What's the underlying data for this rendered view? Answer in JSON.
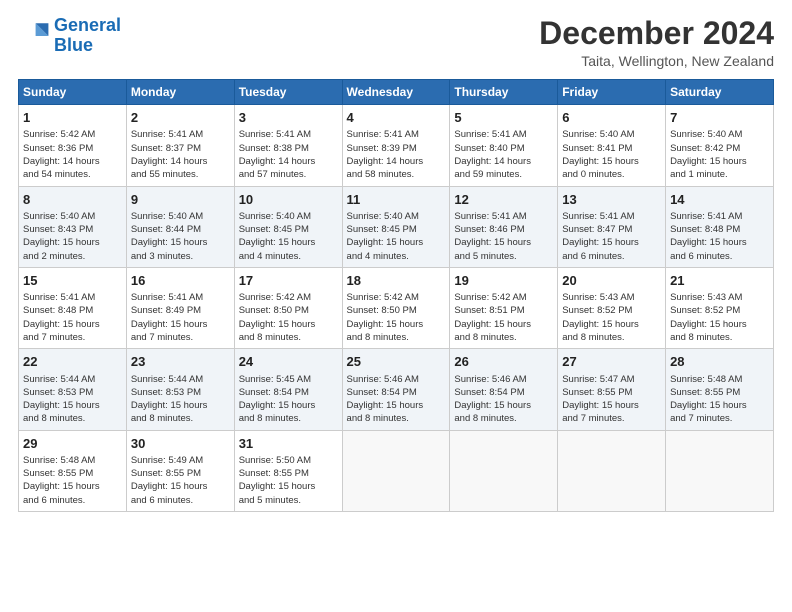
{
  "header": {
    "logo_line1": "General",
    "logo_line2": "Blue",
    "title": "December 2024",
    "subtitle": "Taita, Wellington, New Zealand"
  },
  "days_of_week": [
    "Sunday",
    "Monday",
    "Tuesday",
    "Wednesday",
    "Thursday",
    "Friday",
    "Saturday"
  ],
  "weeks": [
    [
      {
        "day": "1",
        "lines": [
          "Sunrise: 5:42 AM",
          "Sunset: 8:36 PM",
          "Daylight: 14 hours",
          "and 54 minutes."
        ]
      },
      {
        "day": "2",
        "lines": [
          "Sunrise: 5:41 AM",
          "Sunset: 8:37 PM",
          "Daylight: 14 hours",
          "and 55 minutes."
        ]
      },
      {
        "day": "3",
        "lines": [
          "Sunrise: 5:41 AM",
          "Sunset: 8:38 PM",
          "Daylight: 14 hours",
          "and 57 minutes."
        ]
      },
      {
        "day": "4",
        "lines": [
          "Sunrise: 5:41 AM",
          "Sunset: 8:39 PM",
          "Daylight: 14 hours",
          "and 58 minutes."
        ]
      },
      {
        "day": "5",
        "lines": [
          "Sunrise: 5:41 AM",
          "Sunset: 8:40 PM",
          "Daylight: 14 hours",
          "and 59 minutes."
        ]
      },
      {
        "day": "6",
        "lines": [
          "Sunrise: 5:40 AM",
          "Sunset: 8:41 PM",
          "Daylight: 15 hours",
          "and 0 minutes."
        ]
      },
      {
        "day": "7",
        "lines": [
          "Sunrise: 5:40 AM",
          "Sunset: 8:42 PM",
          "Daylight: 15 hours",
          "and 1 minute."
        ]
      }
    ],
    [
      {
        "day": "8",
        "lines": [
          "Sunrise: 5:40 AM",
          "Sunset: 8:43 PM",
          "Daylight: 15 hours",
          "and 2 minutes."
        ]
      },
      {
        "day": "9",
        "lines": [
          "Sunrise: 5:40 AM",
          "Sunset: 8:44 PM",
          "Daylight: 15 hours",
          "and 3 minutes."
        ]
      },
      {
        "day": "10",
        "lines": [
          "Sunrise: 5:40 AM",
          "Sunset: 8:45 PM",
          "Daylight: 15 hours",
          "and 4 minutes."
        ]
      },
      {
        "day": "11",
        "lines": [
          "Sunrise: 5:40 AM",
          "Sunset: 8:45 PM",
          "Daylight: 15 hours",
          "and 4 minutes."
        ]
      },
      {
        "day": "12",
        "lines": [
          "Sunrise: 5:41 AM",
          "Sunset: 8:46 PM",
          "Daylight: 15 hours",
          "and 5 minutes."
        ]
      },
      {
        "day": "13",
        "lines": [
          "Sunrise: 5:41 AM",
          "Sunset: 8:47 PM",
          "Daylight: 15 hours",
          "and 6 minutes."
        ]
      },
      {
        "day": "14",
        "lines": [
          "Sunrise: 5:41 AM",
          "Sunset: 8:48 PM",
          "Daylight: 15 hours",
          "and 6 minutes."
        ]
      }
    ],
    [
      {
        "day": "15",
        "lines": [
          "Sunrise: 5:41 AM",
          "Sunset: 8:48 PM",
          "Daylight: 15 hours",
          "and 7 minutes."
        ]
      },
      {
        "day": "16",
        "lines": [
          "Sunrise: 5:41 AM",
          "Sunset: 8:49 PM",
          "Daylight: 15 hours",
          "and 7 minutes."
        ]
      },
      {
        "day": "17",
        "lines": [
          "Sunrise: 5:42 AM",
          "Sunset: 8:50 PM",
          "Daylight: 15 hours",
          "and 8 minutes."
        ]
      },
      {
        "day": "18",
        "lines": [
          "Sunrise: 5:42 AM",
          "Sunset: 8:50 PM",
          "Daylight: 15 hours",
          "and 8 minutes."
        ]
      },
      {
        "day": "19",
        "lines": [
          "Sunrise: 5:42 AM",
          "Sunset: 8:51 PM",
          "Daylight: 15 hours",
          "and 8 minutes."
        ]
      },
      {
        "day": "20",
        "lines": [
          "Sunrise: 5:43 AM",
          "Sunset: 8:52 PM",
          "Daylight: 15 hours",
          "and 8 minutes."
        ]
      },
      {
        "day": "21",
        "lines": [
          "Sunrise: 5:43 AM",
          "Sunset: 8:52 PM",
          "Daylight: 15 hours",
          "and 8 minutes."
        ]
      }
    ],
    [
      {
        "day": "22",
        "lines": [
          "Sunrise: 5:44 AM",
          "Sunset: 8:53 PM",
          "Daylight: 15 hours",
          "and 8 minutes."
        ]
      },
      {
        "day": "23",
        "lines": [
          "Sunrise: 5:44 AM",
          "Sunset: 8:53 PM",
          "Daylight: 15 hours",
          "and 8 minutes."
        ]
      },
      {
        "day": "24",
        "lines": [
          "Sunrise: 5:45 AM",
          "Sunset: 8:54 PM",
          "Daylight: 15 hours",
          "and 8 minutes."
        ]
      },
      {
        "day": "25",
        "lines": [
          "Sunrise: 5:46 AM",
          "Sunset: 8:54 PM",
          "Daylight: 15 hours",
          "and 8 minutes."
        ]
      },
      {
        "day": "26",
        "lines": [
          "Sunrise: 5:46 AM",
          "Sunset: 8:54 PM",
          "Daylight: 15 hours",
          "and 8 minutes."
        ]
      },
      {
        "day": "27",
        "lines": [
          "Sunrise: 5:47 AM",
          "Sunset: 8:55 PM",
          "Daylight: 15 hours",
          "and 7 minutes."
        ]
      },
      {
        "day": "28",
        "lines": [
          "Sunrise: 5:48 AM",
          "Sunset: 8:55 PM",
          "Daylight: 15 hours",
          "and 7 minutes."
        ]
      }
    ],
    [
      {
        "day": "29",
        "lines": [
          "Sunrise: 5:48 AM",
          "Sunset: 8:55 PM",
          "Daylight: 15 hours",
          "and 6 minutes."
        ]
      },
      {
        "day": "30",
        "lines": [
          "Sunrise: 5:49 AM",
          "Sunset: 8:55 PM",
          "Daylight: 15 hours",
          "and 6 minutes."
        ]
      },
      {
        "day": "31",
        "lines": [
          "Sunrise: 5:50 AM",
          "Sunset: 8:55 PM",
          "Daylight: 15 hours",
          "and 5 minutes."
        ]
      },
      {
        "day": "",
        "lines": []
      },
      {
        "day": "",
        "lines": []
      },
      {
        "day": "",
        "lines": []
      },
      {
        "day": "",
        "lines": []
      }
    ]
  ]
}
